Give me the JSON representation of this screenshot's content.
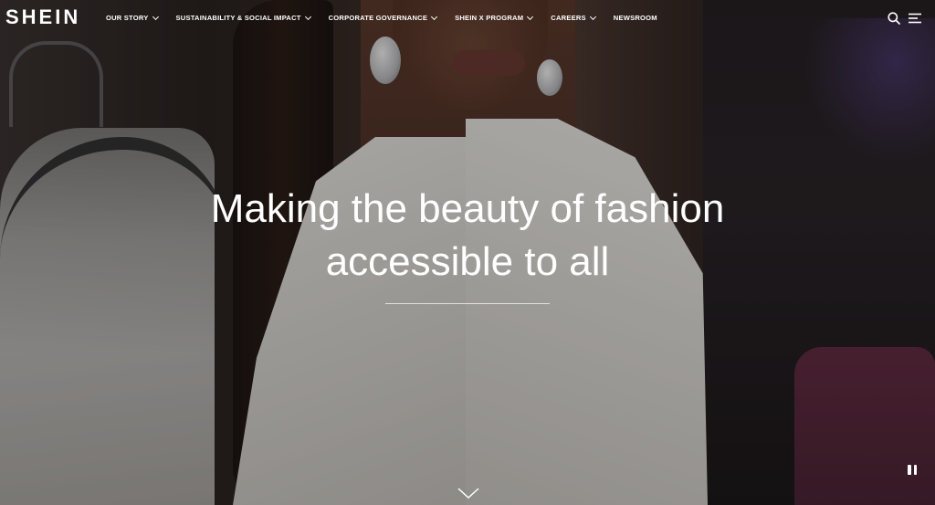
{
  "brand": {
    "logo_text": "SHEIN"
  },
  "nav": {
    "items": [
      {
        "label": "OUR STORY",
        "has_dropdown": true
      },
      {
        "label": "SUSTAINABILITY & SOCIAL IMPACT",
        "has_dropdown": true
      },
      {
        "label": "CORPORATE GOVERNANCE",
        "has_dropdown": true
      },
      {
        "label": "SHEIN X PROGRAM",
        "has_dropdown": true
      },
      {
        "label": "CAREERS",
        "has_dropdown": true
      },
      {
        "label": "NEWSROOM",
        "has_dropdown": false
      }
    ],
    "icons": {
      "search": "search-icon",
      "menu": "hamburger-menu-icon"
    }
  },
  "hero": {
    "headline_line1": "Making the beauty of fashion",
    "headline_line2": "accessible to all",
    "scroll_icon": "chevron-down-icon",
    "video_control_icon": "pause-icon"
  },
  "colors": {
    "text": "#ffffff",
    "overlay": "#000000"
  }
}
